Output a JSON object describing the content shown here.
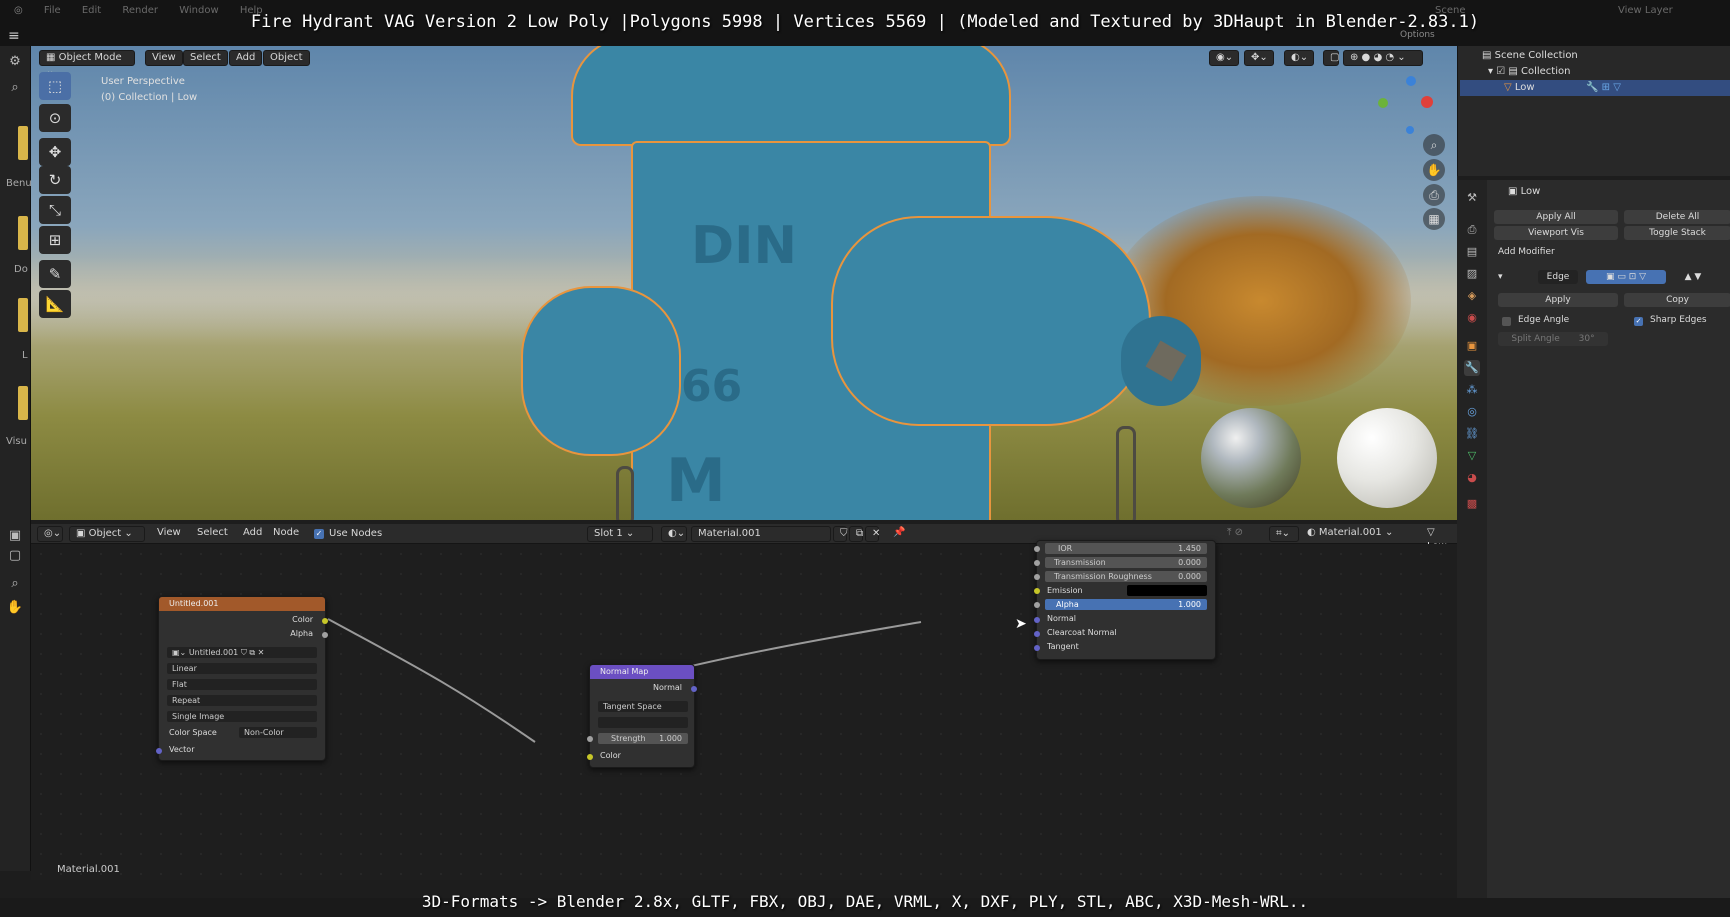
{
  "overlay": {
    "title": "Fire Hydrant VAG Version 2 Low Poly |Polygons 5998 | Vertices 5569 | (Modeled and Textured by 3DHaupt in Blender-2.83.1)",
    "bottom_caption": "3D-Formats -> Blender 2.8x, GLTF, FBX, OBJ, DAE, VRML, X, DXF, PLY, STL, ABC, X3D-Mesh-WRL.."
  },
  "top_menu": [
    "File",
    "Edit",
    "Render",
    "Window",
    "Help"
  ],
  "top_right": {
    "scene": "Scene",
    "view_layer": "View Layer",
    "options": "Options"
  },
  "viewport": {
    "mode": "Object Mode",
    "menus": [
      "View",
      "Select",
      "Add",
      "Object"
    ],
    "info_line1": "User Perspective",
    "info_line2": "(0) Collection | Low",
    "hydrant_text_din": "DIN",
    "hydrant_text_num": "66",
    "hydrant_text_m": "M",
    "tools": [
      "select-box",
      "cursor",
      "move",
      "rotate",
      "scale",
      "transform",
      "annotate",
      "measure"
    ]
  },
  "left_strip_labels": [
    "Benu",
    "Do",
    "L",
    "Visu"
  ],
  "node_editor": {
    "editor_type": "Object",
    "menus": [
      "View",
      "Select",
      "Add",
      "Node"
    ],
    "use_nodes_label": "Use Nodes",
    "slot": "Slot 1",
    "material": "Material.001",
    "material_right": "Material.001",
    "object_right": "Low",
    "footer_label": "Material.001",
    "image_node": {
      "title": "Untitled.001",
      "out_color": "Color",
      "out_alpha": "Alpha",
      "image_name": "Untitled.001",
      "interpolation": "Linear",
      "projection": "Flat",
      "extension": "Repeat",
      "source": "Single Image",
      "color_space_label": "Color Space",
      "color_space_value": "Non-Color",
      "in_vector": "Vector"
    },
    "normal_map_node": {
      "title": "Normal Map",
      "out_normal": "Normal",
      "space": "Tangent Space",
      "uv": "",
      "strength_label": "Strength",
      "strength_value": "1.000",
      "in_color": "Color"
    },
    "bsdf_node": {
      "rows": [
        {
          "label": "IOR",
          "value": "1.450"
        },
        {
          "label": "Transmission",
          "value": "0.000"
        },
        {
          "label": "Transmission Roughness",
          "value": "0.000"
        }
      ],
      "emission": "Emission",
      "alpha_label": "Alpha",
      "alpha_value": "1.000",
      "normal": "Normal",
      "clearcoat_normal": "Clearcoat Normal",
      "tangent": "Tangent"
    }
  },
  "outliner": {
    "scene_collection": "Scene Collection",
    "collection": "Collection",
    "object": "Low"
  },
  "properties": {
    "object_name": "Low",
    "apply_all": "Apply All",
    "delete_all": "Delete All",
    "viewport_vis": "Viewport Vis",
    "toggle_stack": "Toggle Stack",
    "add_modifier": "Add Modifier",
    "modifier_name": "Edge",
    "apply": "Apply",
    "copy": "Copy",
    "edge_angle": "Edge Angle",
    "sharp_edges": "Sharp Edges",
    "split_angle_label": "Split Angle",
    "split_angle_value": "30°"
  },
  "colors": {
    "accent_blue": "#4772b3",
    "selection_orange": "#e8953e",
    "hydrant_blue": "#3a86a5",
    "image_node_header": "#a2592a",
    "normal_map_header": "#6b4fc2",
    "socket_yellow": "#c7c729",
    "socket_purple": "#6363c7"
  }
}
